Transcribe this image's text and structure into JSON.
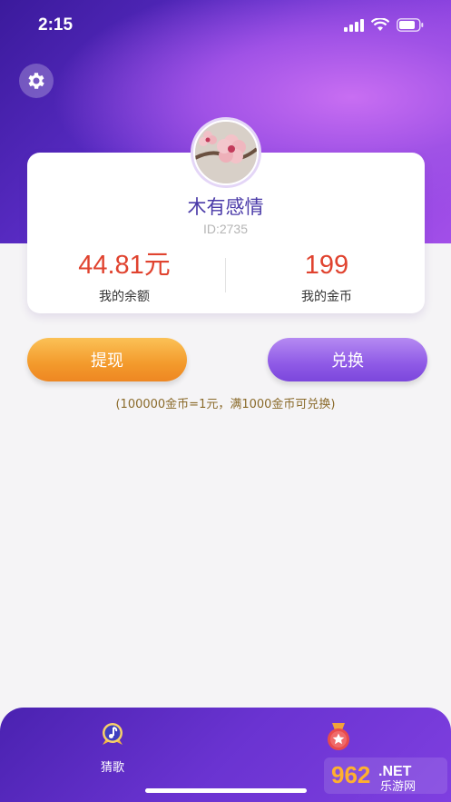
{
  "status_bar": {
    "time": "2:15"
  },
  "profile": {
    "name": "木有感情",
    "id_text": "ID:2735"
  },
  "stats": {
    "balance_value": "44.81元",
    "balance_label": "我的余额",
    "coins_value": "199",
    "coins_label": "我的金币"
  },
  "actions": {
    "withdraw_label": "提现",
    "exchange_label": "兑换",
    "note": "(100000金币=1元，满1000金币可兑换)"
  },
  "tabbar": {
    "tabs": [
      {
        "label": "猜歌",
        "icon": "music-note-icon"
      },
      {
        "label": "",
        "icon": "medal-icon"
      }
    ]
  },
  "watermark": {
    "text": "962.NET 乐游网"
  },
  "colors": {
    "accent_purple": "#6a33d1",
    "value_red": "#e0432f",
    "withdraw_orange": "#f39a2c",
    "exchange_purple": "#8f5ae6"
  }
}
